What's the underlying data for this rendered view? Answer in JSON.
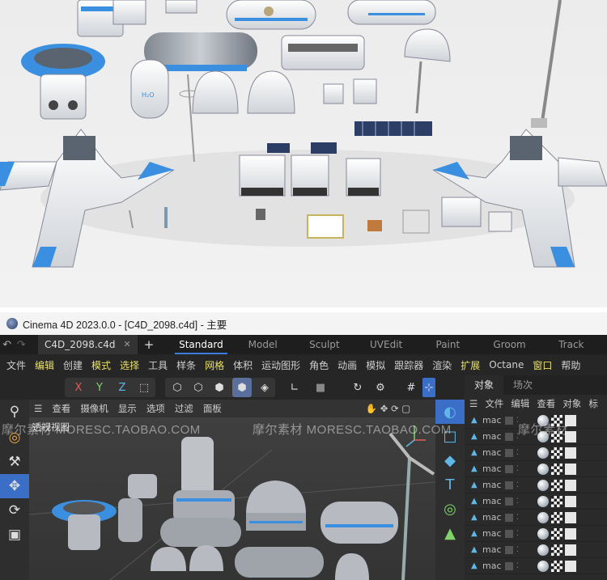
{
  "window": {
    "title": "Cinema 4D 2023.0.0 - [C4D_2098.c4d] - 主要"
  },
  "tabs": {
    "file_tab": "C4D_2098.c4d",
    "layouts": [
      "Standard",
      "Model",
      "Sculpt",
      "UVEdit",
      "Paint",
      "Groom",
      "Track"
    ],
    "active_layout": "Standard"
  },
  "menu": [
    "文件",
    "编辑",
    "创建",
    "模式",
    "选择",
    "工具",
    "样条",
    "网格",
    "体积",
    "运动图形",
    "角色",
    "动画",
    "模拟",
    "跟踪器",
    "渲染",
    "扩展",
    "Octane",
    "窗口",
    "帮助"
  ],
  "menu_highlighted": [
    "编辑",
    "模式",
    "选择",
    "网格",
    "扩展",
    "窗口"
  ],
  "toolbar": {
    "axis_x": "X",
    "axis_y": "Y",
    "axis_z": "Z"
  },
  "viewport": {
    "menu": [
      "查看",
      "摄像机",
      "显示",
      "选项",
      "过滤",
      "面板"
    ],
    "label": "透视视图"
  },
  "object_panel": {
    "tabs": [
      "对象",
      "场次"
    ],
    "active_tab": "对象",
    "menu": [
      "文件",
      "编辑",
      "查看",
      "对象",
      "标"
    ],
    "rows": [
      "mac",
      "mac",
      "mac",
      "mac",
      "mac",
      "mac",
      "mac",
      "mac",
      "mac",
      "mac"
    ]
  },
  "watermarks": [
    "摩尔素材 MORESC.TAOBAO.COM",
    "摩尔素材 MORESC.TAOBAO.COM",
    "摩尔素材"
  ],
  "colors": {
    "accent_blue": "#3b7ddd",
    "menu_highlight": "#e9e06a",
    "icon_blue": "#5fb7e8",
    "model_blue": "#3a8fe0"
  }
}
